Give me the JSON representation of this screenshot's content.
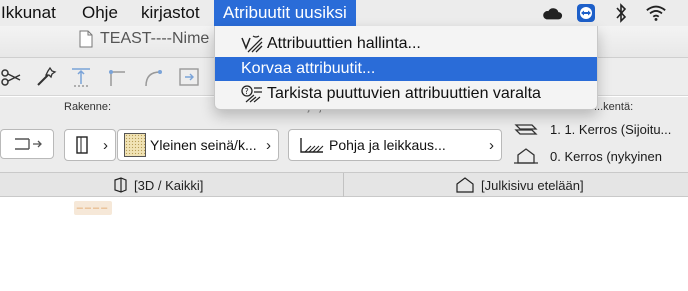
{
  "menubar": {
    "items": [
      "Ikkunat",
      "Ohje",
      "kirjastot"
    ],
    "active": "Atribuutit uusiksi",
    "tray_icons": [
      "cloud-icon",
      "teamviewer-icon",
      "bluetooth-icon",
      "wifi-icon"
    ]
  },
  "window": {
    "title": "TEAST----Nime"
  },
  "dropdown": {
    "items": [
      {
        "label": "Attribuuttien hallinta...",
        "icon": "attribute-manager-icon",
        "highlighted": false
      },
      {
        "label": "Korvaa attribuutit...",
        "icon": "",
        "highlighted": true
      },
      {
        "label": "Tarkista puuttuvien attribuuttien varalta",
        "icon": "check-missing-attributes-icon",
        "highlighted": false
      }
    ]
  },
  "infobox": {
    "structure_label": "Rakenne:",
    "wall_type": "Yleinen seinä/k...",
    "floor_plan_label": "Pohja ja leikkaus:",
    "floor_plan_value": "Pohja ja leikkaus...",
    "story_label": "...kentä:",
    "stories": [
      "1. 1. Kerros (Sijoitu...",
      "0. Kerros (nykyinen"
    ]
  },
  "view_tabs": [
    "[3D / Kaikki]",
    "[Julkisivu etelään]"
  ],
  "colors": {
    "accent": "#2a6cd8",
    "menubar": "#ececec"
  }
}
